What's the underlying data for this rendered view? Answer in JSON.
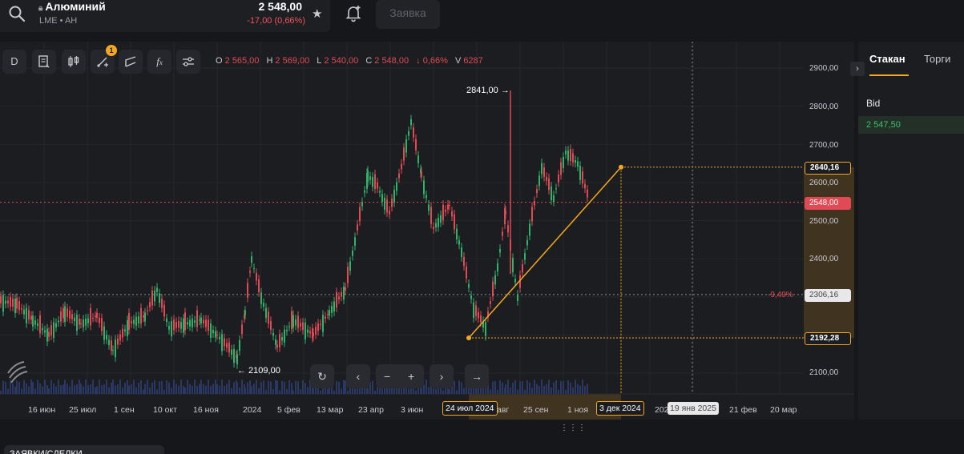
{
  "header": {
    "instrument_name": "Алюминий",
    "instrument_meta": "LME • AH",
    "price": "2 548,00",
    "change": "-17,00 (0,66%)",
    "order_button": "Заявка"
  },
  "toolbar": {
    "interval_label": "D",
    "indicators_badge": "1",
    "ohlc": {
      "o_label": "O",
      "o_value": "2 565,00",
      "h_label": "H",
      "h_value": "2 569,00",
      "l_label": "L",
      "l_value": "2 540,00",
      "c_label": "C",
      "c_value": "2 548,00",
      "change": "↓ 0,66%",
      "v_label": "V",
      "v_value": "6287"
    }
  },
  "chart": {
    "price_ticks": [
      "2900,00",
      "2800,00",
      "2700,00",
      "2600,00",
      "2500,00",
      "2400,00",
      "2100,00"
    ],
    "price_labels": {
      "upper_target": "2640,16",
      "last_price": "2548,00",
      "mid_level": "2306,16",
      "lower_target": "2192,28"
    },
    "mid_level_pct": "-9,49%",
    "annotations": {
      "high": "2841,00 →",
      "low": "← 2109,00"
    },
    "time_labels": [
      "16 июн",
      "25 июл",
      "1 сен",
      "10 окт",
      "16 ноя",
      "2024",
      "5 фев",
      "13 мар",
      "23 апр",
      "3 июн",
      "25 сен",
      "1 ноя",
      "202",
      "21 фев",
      "20 мар"
    ],
    "time_highlight_start": "24 июл 2024",
    "time_partial": "авг",
    "time_highlight_end": "3 дек 2024",
    "time_cursor": "19 янв 2025",
    "colors": {
      "up": "#2fb36b",
      "down": "#e14a55",
      "accent": "#f3a91f"
    }
  },
  "bottom": {
    "tab_label": "ЗАЯВКИ/СДЕЛКИ"
  },
  "right_panel": {
    "tabs": [
      "Стакан",
      "Торги"
    ],
    "bid_label": "Bid",
    "bid_value": "2 547,50"
  }
}
